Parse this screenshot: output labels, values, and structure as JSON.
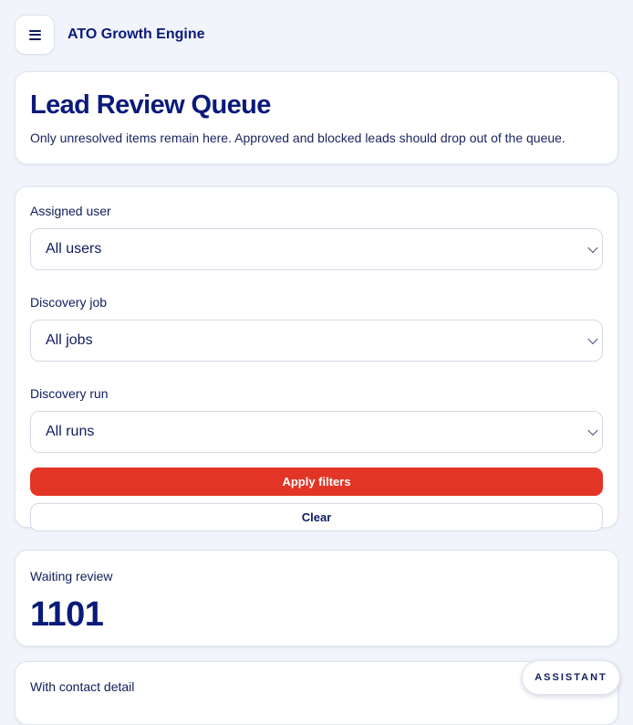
{
  "header": {
    "menu_icon": "hamburger-menu-icon",
    "brand": "ATO Growth Engine"
  },
  "intro": {
    "title": "Lead Review Queue",
    "subtitle": "Only unresolved items remain here. Approved and blocked leads should drop out of the queue."
  },
  "filters": {
    "assigned_user": {
      "label": "Assigned user",
      "value": "All users"
    },
    "discovery_job": {
      "label": "Discovery job",
      "value": "All jobs"
    },
    "discovery_run": {
      "label": "Discovery run",
      "value": "All runs"
    },
    "apply_label": "Apply filters",
    "clear_label": "Clear"
  },
  "stats": {
    "waiting_review": {
      "label": "Waiting review",
      "value": "1101"
    },
    "with_contact_detail": {
      "label": "With contact detail"
    }
  },
  "assistant": {
    "label": "ASSISTANT"
  },
  "colors": {
    "accent": "#e23525",
    "brand": "#0a1a7a",
    "background": "#f1f4fb"
  }
}
